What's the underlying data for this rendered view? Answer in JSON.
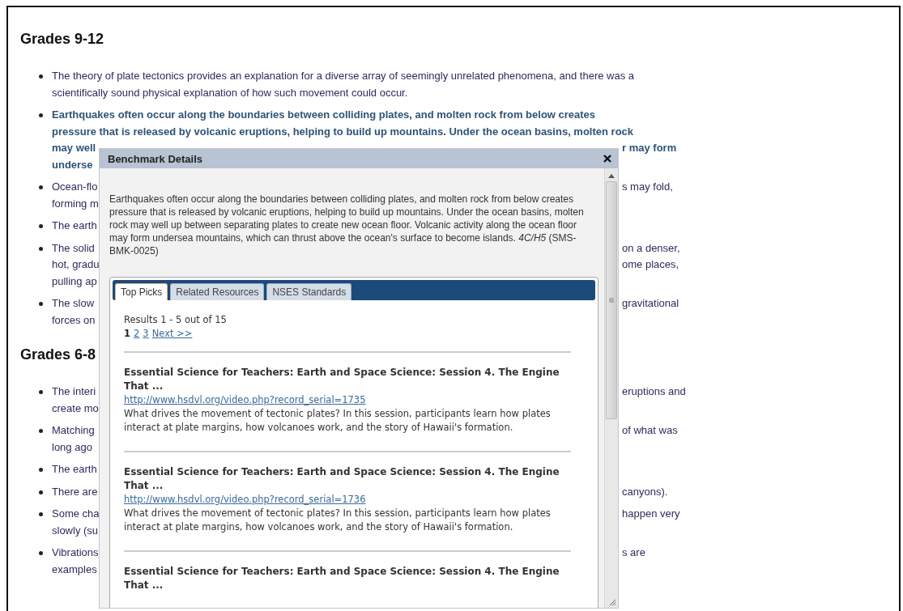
{
  "page": {
    "sections": [
      {
        "heading": "Grades 9-12",
        "items": [
          {
            "highlighted": false,
            "lines": [
              {
                "text": "The theory of plate tectonics provides an explanation for a diverse array of seemingly unrelated phenomena, and there was a"
              },
              {
                "text": "scientifically sound physical explanation of how such movement could occur."
              }
            ]
          },
          {
            "highlighted": true,
            "lines": [
              {
                "text": "Earthquakes often occur along the boundaries between colliding plates, and molten rock from below creates"
              },
              {
                "text": "pressure that is released by volcanic eruptions, helping to build up mountains. Under the ocean basins, molten rock"
              },
              {
                "left": "may well",
                "right": "r may form"
              },
              {
                "left": "underse"
              }
            ]
          },
          {
            "highlighted": false,
            "lines": [
              {
                "left": "Ocean-flo",
                "right": "s may fold,"
              },
              {
                "left": "forming m"
              }
            ]
          },
          {
            "highlighted": false,
            "lines": [
              {
                "left": "The earth"
              }
            ]
          },
          {
            "highlighted": false,
            "lines": [
              {
                "left": "The solid",
                "right": "on a denser,"
              },
              {
                "left": "hot, gradu",
                "right": "ome places,"
              },
              {
                "left": "pulling ap"
              }
            ]
          },
          {
            "highlighted": false,
            "lines": [
              {
                "left": "The slow",
                "right": "gravitational"
              },
              {
                "left": "forces on"
              }
            ]
          }
        ]
      },
      {
        "heading": "Grades 6-8",
        "items": [
          {
            "highlighted": false,
            "lines": [
              {
                "left": "The interi",
                "right": "eruptions and"
              },
              {
                "left": "create mo"
              }
            ]
          },
          {
            "highlighted": false,
            "lines": [
              {
                "left": "Matching",
                "right": "of what was"
              },
              {
                "left": "long ago"
              }
            ]
          },
          {
            "highlighted": false,
            "lines": [
              {
                "left": "The earth"
              }
            ]
          },
          {
            "highlighted": false,
            "lines": [
              {
                "left": "There are",
                "right": "canyons)."
              }
            ]
          },
          {
            "highlighted": false,
            "lines": [
              {
                "left": "Some cha",
                "right": "happen very"
              },
              {
                "left": "slowly (su"
              }
            ]
          },
          {
            "highlighted": false,
            "lines": [
              {
                "left": "Vibrations",
                "right": "s are"
              },
              {
                "left": "examples"
              }
            ]
          }
        ]
      }
    ]
  },
  "dialog": {
    "title": "Benchmark Details",
    "description": "Earthquakes often occur along the boundaries between colliding plates, and molten rock from below creates pressure that is released by volcanic eruptions, helping to build up mountains. Under the ocean basins, molten rock may well up between separating plates to create new ocean floor. Volcanic activity along the ocean floor may form undersea mountains, which can thrust above the ocean's surface to become islands. *4C/H5* (SMS-BMK-0025)",
    "tabs": [
      {
        "label": "Top Picks",
        "selected": true
      },
      {
        "label": "Related Resources",
        "selected": false
      },
      {
        "label": "NSES Standards",
        "selected": false
      }
    ],
    "results_summary": "Results 1 - 5 out of 15",
    "pages": [
      {
        "label": "1",
        "selected": true
      },
      {
        "label": "2",
        "selected": false
      },
      {
        "label": "3",
        "selected": false
      }
    ],
    "next": "Next >>",
    "results": [
      {
        "title": "Essential Science for Teachers: Earth and Space Science: Session 4. The Engine That ...",
        "url": "http://www.hsdvl.org/video.php?record_serial=1735",
        "description": "What drives the movement of tectonic plates? In this session, participants learn how plates interact at plate margins, how volcanoes work, and the story of Hawaii's formation."
      },
      {
        "title": "Essential Science for Teachers: Earth and Space Science: Session 4. The Engine That ...",
        "url": "http://www.hsdvl.org/video.php?record_serial=1736",
        "description": "What drives the movement of tectonic plates? In this session, participants learn how plates interact at plate margins, how volcanoes work, and the story of Hawaii's formation."
      },
      {
        "title": "Essential Science for Teachers: Earth and Space Science: Session 4. The Engine That ..."
      }
    ]
  }
}
